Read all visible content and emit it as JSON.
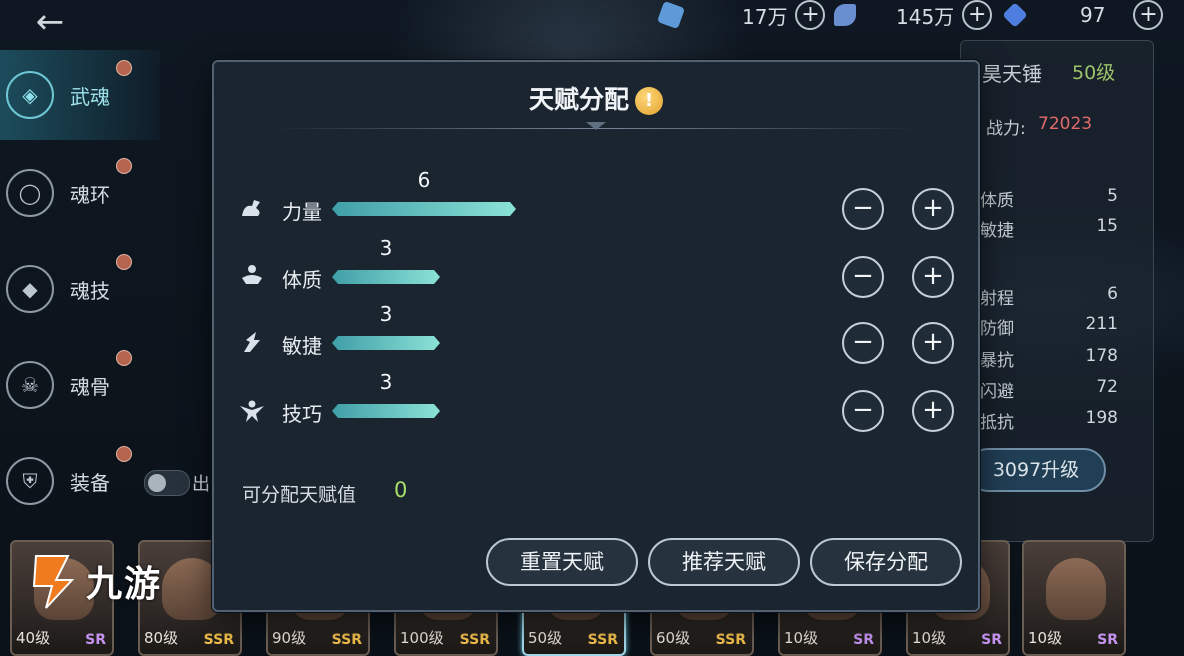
{
  "header": {
    "resources": [
      {
        "icon": "crystal-icon",
        "value": "17万",
        "color": "#5e9ad8"
      },
      {
        "icon": "soul-icon",
        "value": "145万",
        "color": "#6a8fd0"
      },
      {
        "icon": "diamond-icon",
        "value": "97",
        "color": "#4e7fe0"
      }
    ],
    "plus_label": "+"
  },
  "sidebar": {
    "items": [
      {
        "label": "武魂",
        "icon": "spirit-icon",
        "active": true
      },
      {
        "label": "魂环",
        "icon": "ring-icon",
        "active": false
      },
      {
        "label": "魂技",
        "icon": "skill-icon",
        "active": false
      },
      {
        "label": "魂骨",
        "icon": "bone-icon",
        "active": false
      },
      {
        "label": "装备",
        "icon": "equipment-icon",
        "active": false
      }
    ],
    "toggle_label": "出"
  },
  "hero_panel": {
    "name": "昊天锤",
    "level": "50级",
    "power_label": "战力:",
    "power_value": "72023",
    "stats": [
      {
        "label": "体质",
        "value": "5"
      },
      {
        "label": "敏捷",
        "value": "15"
      },
      {
        "label": "射程",
        "value": "6"
      },
      {
        "label": "防御",
        "value": "211"
      },
      {
        "label": "暴抗",
        "value": "178"
      },
      {
        "label": "闪避",
        "value": "72"
      },
      {
        "label": "抵抗",
        "value": "198"
      }
    ],
    "upgrade_label": "3097升级"
  },
  "modal": {
    "title": "天赋分配",
    "info_glyph": "!",
    "talents": [
      {
        "label": "力量",
        "value": 6,
        "icon": "strength-icon"
      },
      {
        "label": "体质",
        "value": 3,
        "icon": "constitution-icon"
      },
      {
        "label": "敏捷",
        "value": 3,
        "icon": "agility-icon"
      },
      {
        "label": "技巧",
        "value": 3,
        "icon": "technique-icon"
      }
    ],
    "minus_label": "−",
    "plus_label": "+",
    "available_label": "可分配天赋值",
    "available_value": "0",
    "buttons": {
      "reset": "重置天赋",
      "recommend": "推荐天赋",
      "save": "保存分配"
    }
  },
  "roster": [
    {
      "level": "40级",
      "rarity": "SR"
    },
    {
      "level": "80级",
      "rarity": "SSR"
    },
    {
      "level": "90级",
      "rarity": "SSR"
    },
    {
      "level": "100级",
      "rarity": "SSR"
    },
    {
      "level": "50级",
      "rarity": "SSR",
      "selected": true
    },
    {
      "level": "60级",
      "rarity": "SSR"
    },
    {
      "level": "10级",
      "rarity": "SR"
    },
    {
      "level": "10级",
      "rarity": "SR"
    },
    {
      "level": "10级",
      "rarity": "SR"
    }
  ],
  "watermark": {
    "text": "九游",
    "color": "#f07a1e"
  },
  "colors": {
    "accent": "#8be2d6",
    "available": "#a6e06a",
    "power": "#e06a6a",
    "level": "#9bc36a"
  }
}
